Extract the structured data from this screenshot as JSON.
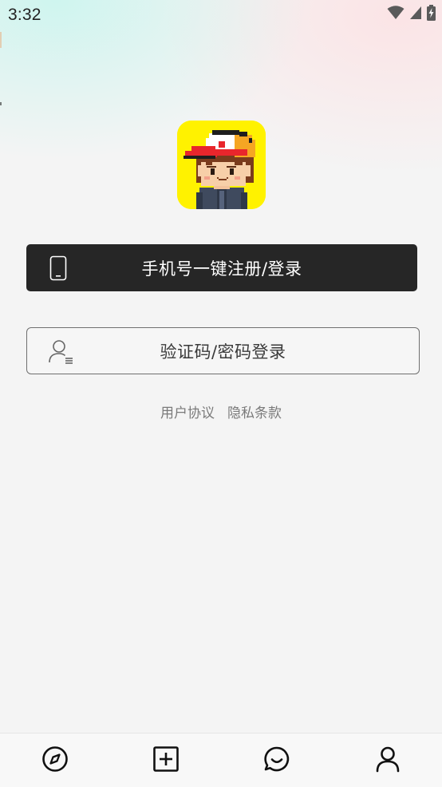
{
  "status_bar": {
    "time": "3:32",
    "icons": [
      "wifi-icon",
      "signal-icon",
      "battery-charging-icon"
    ]
  },
  "logo": {
    "icon": "pixel-boy-cap-avatar",
    "background": "#fff200"
  },
  "login": {
    "phone_button_label": "手机号一键注册/登录",
    "phone_button_icon": "phone-icon",
    "code_button_label": "验证码/密码登录",
    "code_button_icon": "user-list-icon"
  },
  "agreements": {
    "user_agreement": "用户协议",
    "privacy_policy": "隐私条款"
  },
  "bottom_nav": {
    "items": [
      {
        "icon": "compass-icon"
      },
      {
        "icon": "add-square-icon"
      },
      {
        "icon": "chat-bubble-icon"
      },
      {
        "icon": "person-icon"
      }
    ]
  },
  "colors": {
    "primary_button": "#262626",
    "text_muted": "#7a7a7a",
    "logo_yellow": "#fff200"
  }
}
